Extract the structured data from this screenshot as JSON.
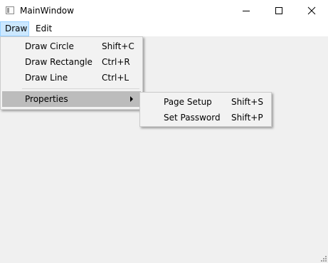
{
  "window": {
    "title": "MainWindow"
  },
  "menubar": {
    "items": [
      {
        "label": "Draw"
      },
      {
        "label": "Edit"
      }
    ]
  },
  "draw_menu": {
    "items": [
      {
        "label": "Draw Circle",
        "shortcut": "Shift+C"
      },
      {
        "label": "Draw Rectangle",
        "shortcut": "Ctrl+R"
      },
      {
        "label": "Draw Line",
        "shortcut": "Ctrl+L"
      },
      {
        "label": "Properties",
        "has_submenu": true
      }
    ]
  },
  "properties_submenu": {
    "items": [
      {
        "label": "Page Setup",
        "shortcut": "Shift+S"
      },
      {
        "label": "Set Password",
        "shortcut": "Shift+P"
      }
    ]
  },
  "icons": {
    "app": "app-window-icon",
    "minimize": "minimize-icon",
    "maximize": "maximize-icon",
    "close": "close-icon",
    "submenu": "submenu-arrow-icon",
    "resize": "resize-grip-icon"
  },
  "colors": {
    "titlebar_bg": "#ffffff",
    "client_bg": "#f0f0f0",
    "menu_bg": "#f2f2f2",
    "menu_highlight": "#bcbcbc",
    "menubar_active": "#cce8ff"
  }
}
